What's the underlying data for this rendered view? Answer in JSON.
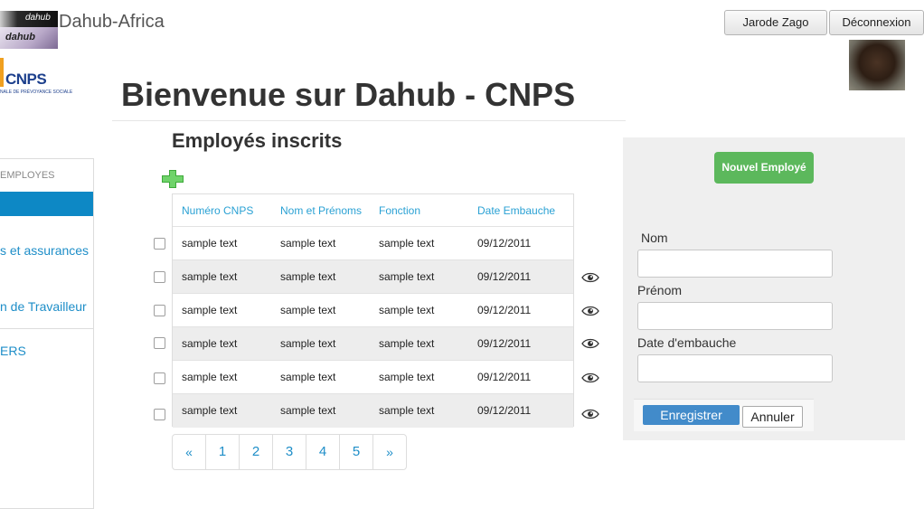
{
  "header": {
    "app_name": "Dahub-Africa",
    "logo_text_top": "dahub",
    "logo_text_bottom": "dahub",
    "user_button": "Jarode Zago",
    "logout_button": "Déconnexion"
  },
  "cnps_logo": {
    "text": "CNPS",
    "subtitle": "NALE DE PRÉVOYANCE SOCIALE"
  },
  "page_title": "Bienvenue sur Dahub - CNPS",
  "sidebar": {
    "heading": "EMPLOYES",
    "items": [
      {
        "label": "s et assurances"
      },
      {
        "label": "n de Travailleur"
      },
      {
        "label": "ERS"
      }
    ]
  },
  "table": {
    "title": "Employés inscrits",
    "columns": [
      "Numéro CNPS",
      "Nom et Prénoms",
      "Fonction",
      "Date Embauche"
    ],
    "rows": [
      [
        "sample text",
        "sample text",
        "sample text",
        "09/12/2011"
      ],
      [
        "sample text",
        "sample text",
        "sample text",
        "09/12/2011"
      ],
      [
        "sample text",
        "sample text",
        "sample text",
        "09/12/2011"
      ],
      [
        "sample text",
        "sample text",
        "sample text",
        "09/12/2011"
      ],
      [
        "sample text",
        "sample text",
        "sample text",
        "09/12/2011"
      ],
      [
        "sample text",
        "sample text",
        "sample text",
        "09/12/2011"
      ]
    ]
  },
  "pagination": [
    "«",
    "1",
    "2",
    "3",
    "4",
    "5",
    "»"
  ],
  "form": {
    "new_button": "Nouvel Employé",
    "fields": [
      {
        "label": "Nom",
        "value": ""
      },
      {
        "label": "Prénom",
        "value": ""
      },
      {
        "label": "Date d'embauche",
        "value": ""
      }
    ],
    "save_button": "Enregistrer",
    "cancel_button": "Annuler"
  },
  "colors": {
    "accent": "#0d88c5",
    "link": "#1e8ec8",
    "success": "#5cb85c",
    "primary": "#428bca"
  }
}
